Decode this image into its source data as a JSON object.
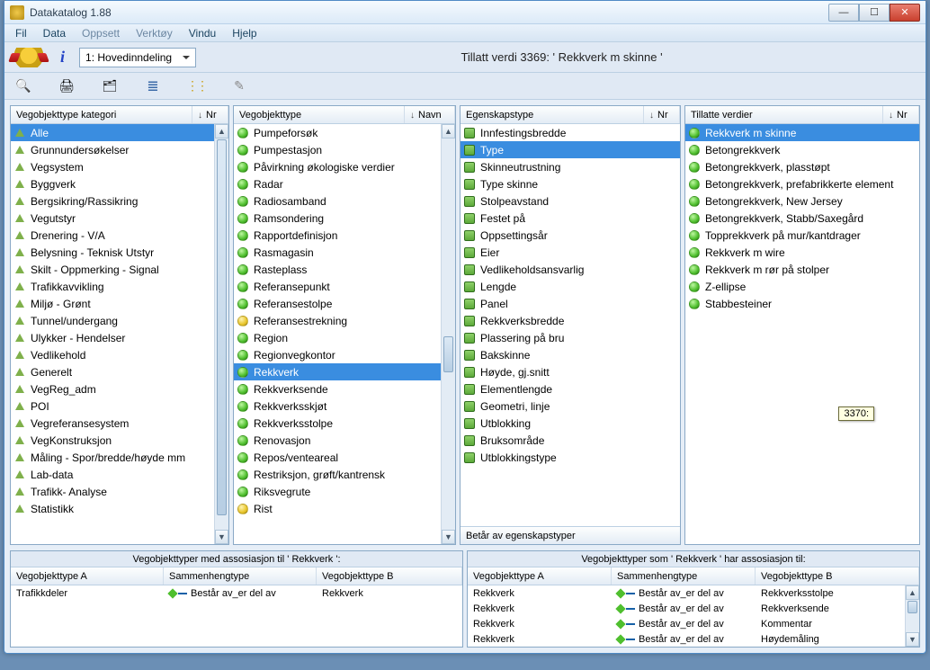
{
  "window": {
    "title": "Datakatalog 1.88"
  },
  "menu": [
    "Fil",
    "Data",
    "Oppsett",
    "Verktøy",
    "Vindu",
    "Hjelp"
  ],
  "menu_dim": [
    false,
    false,
    true,
    true,
    false,
    false
  ],
  "toolbar": {
    "combo": "1: Hovedinndeling",
    "header": "Tillatt verdi 3369:   ' Rekkverk m skinne '"
  },
  "tooltip": "3370:",
  "panels": {
    "kat": {
      "h1": "Vegobjekttype kategori",
      "h2": "Nr",
      "items": [
        {
          "t": "Alle",
          "sel": true
        },
        {
          "t": "Grunnundersøkelser"
        },
        {
          "t": "Vegsystem"
        },
        {
          "t": "Byggverk"
        },
        {
          "t": "Bergsikring/Rassikring"
        },
        {
          "t": "Vegutstyr"
        },
        {
          "t": "Drenering - V/A"
        },
        {
          "t": "Belysning - Teknisk Utstyr"
        },
        {
          "t": "Skilt - Oppmerking - Signal"
        },
        {
          "t": "Trafikkavvikling"
        },
        {
          "t": "Miljø - Grønt"
        },
        {
          "t": "Tunnel/undergang"
        },
        {
          "t": "Ulykker - Hendelser"
        },
        {
          "t": "Vedlikehold"
        },
        {
          "t": "Generelt"
        },
        {
          "t": "VegReg_adm"
        },
        {
          "t": "POI"
        },
        {
          "t": "Vegreferansesystem"
        },
        {
          "t": "VegKonstruksjon"
        },
        {
          "t": "Måling - Spor/bredde/høyde mm"
        },
        {
          "t": "Lab-data"
        },
        {
          "t": "Trafikk-  Analyse"
        },
        {
          "t": "Statistikk"
        }
      ]
    },
    "obj": {
      "h1": "Vegobjekttype",
      "h2": "Navn",
      "items": [
        {
          "t": "Pumpeforsøk"
        },
        {
          "t": "Pumpestasjon"
        },
        {
          "t": "Påvirkning økologiske verdier"
        },
        {
          "t": "Radar"
        },
        {
          "t": "Radiosamband"
        },
        {
          "t": "Ramsondering"
        },
        {
          "t": "Rapportdefinisjon"
        },
        {
          "t": "Rasmagasin"
        },
        {
          "t": "Rasteplass"
        },
        {
          "t": "Referansepunkt"
        },
        {
          "t": "Referansestolpe"
        },
        {
          "t": "Referansestrekning",
          "c": "yellow"
        },
        {
          "t": "Region"
        },
        {
          "t": "Regionvegkontor"
        },
        {
          "t": "Rekkverk",
          "sel": true
        },
        {
          "t": "Rekkverksende"
        },
        {
          "t": "Rekkverksskjøt"
        },
        {
          "t": "Rekkverksstolpe"
        },
        {
          "t": "Renovasjon"
        },
        {
          "t": "Repos/venteareal"
        },
        {
          "t": "Restriksjon, grøft/kantrensk"
        },
        {
          "t": "Riksvegrute"
        },
        {
          "t": "Rist",
          "c": "yellow"
        }
      ]
    },
    "egen": {
      "h1": "Egenskapstype",
      "h2": "Nr",
      "footer": "Betår av egenskapstyper",
      "items": [
        {
          "t": "Innfestingsbredde"
        },
        {
          "t": "Type",
          "sel": true
        },
        {
          "t": "Skinneutrustning"
        },
        {
          "t": "Type skinne"
        },
        {
          "t": "Stolpeavstand"
        },
        {
          "t": "Festet på"
        },
        {
          "t": "Oppsettingsår"
        },
        {
          "t": "Eier"
        },
        {
          "t": "Vedlikeholdsansvarlig"
        },
        {
          "t": "Lengde"
        },
        {
          "t": "Panel"
        },
        {
          "t": "Rekkverksbredde"
        },
        {
          "t": "Plassering på bru"
        },
        {
          "t": "Bakskinne"
        },
        {
          "t": "Høyde, gj.snitt"
        },
        {
          "t": "Elementlengde"
        },
        {
          "t": "Geometri, linje"
        },
        {
          "t": "Utblokking"
        },
        {
          "t": "Bruksområde"
        },
        {
          "t": "Utblokkingstype"
        }
      ]
    },
    "till": {
      "h1": "Tillatte verdier",
      "h2": "Nr",
      "items": [
        {
          "t": "Rekkverk m skinne",
          "sel": true
        },
        {
          "t": "Betongrekkverk"
        },
        {
          "t": "Betongrekkverk, plasstøpt"
        },
        {
          "t": "Betongrekkverk, prefabrikkerte element"
        },
        {
          "t": "Betongrekkverk, New Jersey"
        },
        {
          "t": "Betongrekkverk, Stabb/Saxegård"
        },
        {
          "t": "Topprekkverk på mur/kantdrager"
        },
        {
          "t": "Rekkverk m wire"
        },
        {
          "t": "Rekkverk m rør på stolper"
        },
        {
          "t": "Z-ellipse"
        },
        {
          "t": "Stabbesteiner"
        }
      ]
    }
  },
  "assoc": {
    "left": {
      "title": "Vegobjekttyper med assosiasjon til ' Rekkverk ':",
      "cols": [
        "Vegobjekttype A",
        "Sammenhengtype",
        "Vegobjekttype B"
      ],
      "rows": [
        {
          "a": "Trafikkdeler",
          "r": "Består av_er del av",
          "b": "Rekkverk"
        }
      ]
    },
    "right": {
      "title": "Vegobjekttyper som ' Rekkverk ' har assosiasjon til:",
      "cols": [
        "Vegobjekttype A",
        "Sammenhengtype",
        "Vegobjekttype B"
      ],
      "rows": [
        {
          "a": "Rekkverk",
          "r": "Består av_er del av",
          "b": "Rekkverksstolpe"
        },
        {
          "a": "Rekkverk",
          "r": "Består av_er del av",
          "b": "Rekkverksende"
        },
        {
          "a": "Rekkverk",
          "r": "Består av_er del av",
          "b": "Kommentar"
        },
        {
          "a": "Rekkverk",
          "r": "Består av_er del av",
          "b": "Høydemåling"
        }
      ]
    }
  }
}
